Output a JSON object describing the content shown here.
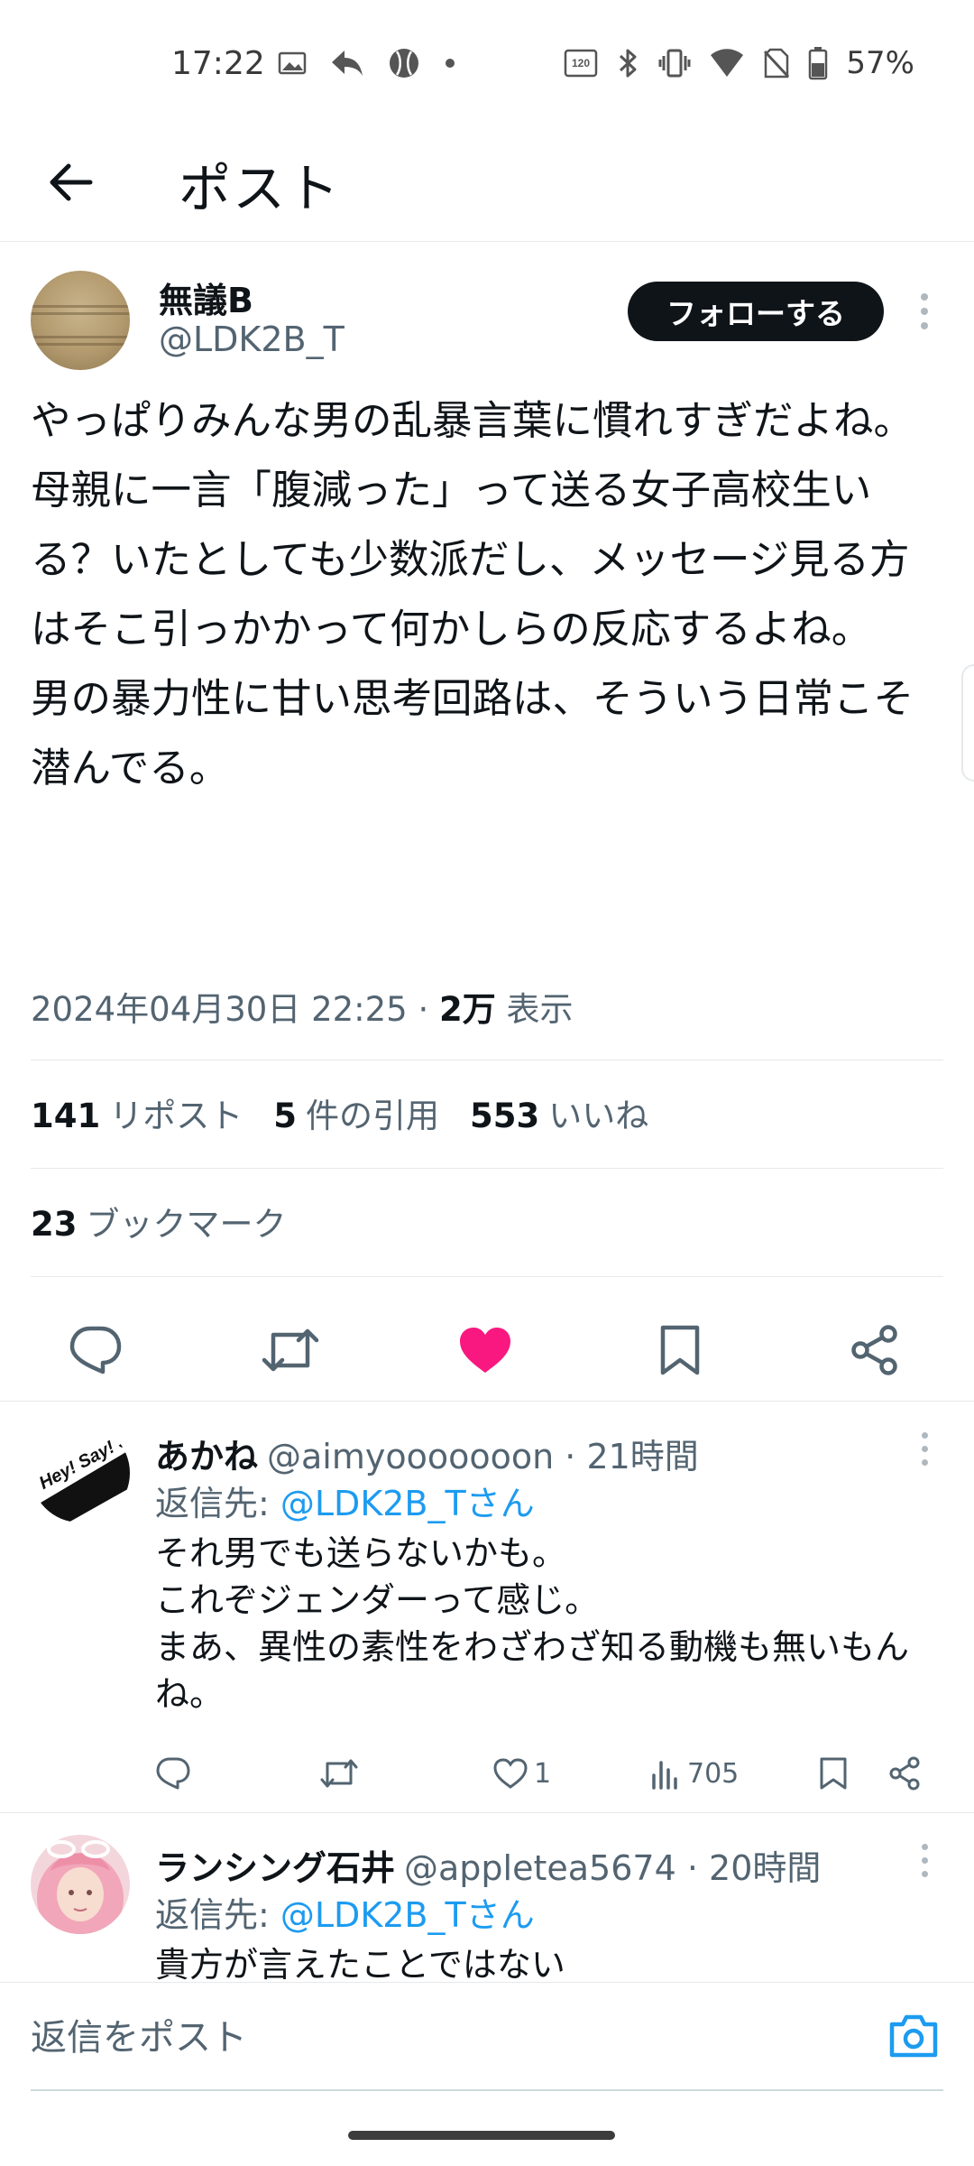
{
  "status_bar": {
    "time": "17:22",
    "battery": "57%",
    "icons_left": [
      "gallery-icon",
      "reply-arrow-icon",
      "baseball-icon",
      "dot-icon"
    ],
    "icons_right": [
      "refresh-rate-120hz-icon",
      "bluetooth-icon",
      "vibrate-icon",
      "wifi-icon",
      "no-sim-icon",
      "battery-icon"
    ],
    "refresh_rate_label": "120"
  },
  "header": {
    "title": "ポスト"
  },
  "post": {
    "author_name": "無議B",
    "author_handle": "@LDK2B_T",
    "follow_label": "フォローする",
    "text": "やっぱりみんな男の乱暴言葉に慣れすぎだよね。\n母親に一言「腹減った」って送る女子高校生いる？いたとしても少数派だし、メッセージ見る方はそこ引っかかって何かしらの反応するよね。\n男の暴力性に甘い思考回路は、そういう日常こそ潜んでる。",
    "datetime": "2024年04月30日 22:25",
    "separator": "·",
    "views_count": "2万",
    "views_label": "表示",
    "reposts_count": "141",
    "reposts_label": "リポスト",
    "quotes_count": "5",
    "quotes_label": "件の引用",
    "likes_count": "553",
    "likes_label": "いいね",
    "bookmarks_count": "23",
    "bookmarks_label": "ブックマーク"
  },
  "replies": [
    {
      "name": "あかね",
      "handle": "@aimyooooooon",
      "time": "· 21時間",
      "reply_to_prefix": "返信先: ",
      "reply_to_link": "@LDK2B_Tさん",
      "text": "それ男でも送らないかも。\nこれぞジェンダーって感じ。\nまあ、異性の素性をわざわざ知る動機も無いもんね。",
      "likes": "1",
      "views": "705",
      "avatar_text": "Hey! Say! JUMP"
    },
    {
      "name": "ランシング石井",
      "handle": "@appletea5674",
      "time": "· 20時間",
      "reply_to_prefix": "返信先: ",
      "reply_to_link": "@LDK2B_Tさん",
      "text": "貴方が言えたことではない"
    }
  ],
  "composer": {
    "placeholder": "返信をポスト"
  },
  "colors": {
    "text_primary": "#0f1419",
    "text_secondary": "#536471",
    "link": "#1d9bf0",
    "like_active": "#f91880",
    "follow_bg": "#0f1419"
  }
}
